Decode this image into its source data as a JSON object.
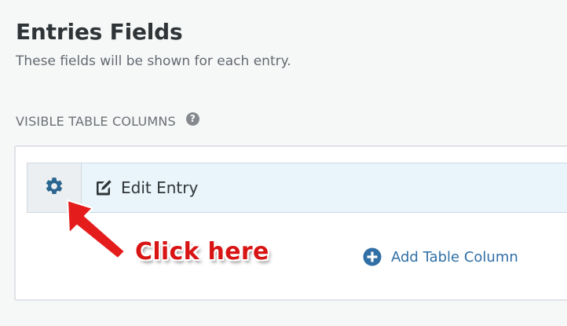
{
  "page": {
    "title": "Entries Fields",
    "description": "These fields will be shown for each entry."
  },
  "section": {
    "label": "VISIBLE TABLE COLUMNS",
    "help_icon": "question-circle-icon"
  },
  "fields": [
    {
      "label": "Edit Entry",
      "icon": "edit-icon",
      "settings_icon": "gear-icon"
    }
  ],
  "add_column": {
    "label": "Add Table Column",
    "icon": "plus-circle-icon"
  },
  "annotation": {
    "text": "Click here",
    "color": "#d81414"
  },
  "colors": {
    "accent": "#2f6fa5",
    "row_background": "#e9f5fb",
    "title": "#2f3437"
  }
}
